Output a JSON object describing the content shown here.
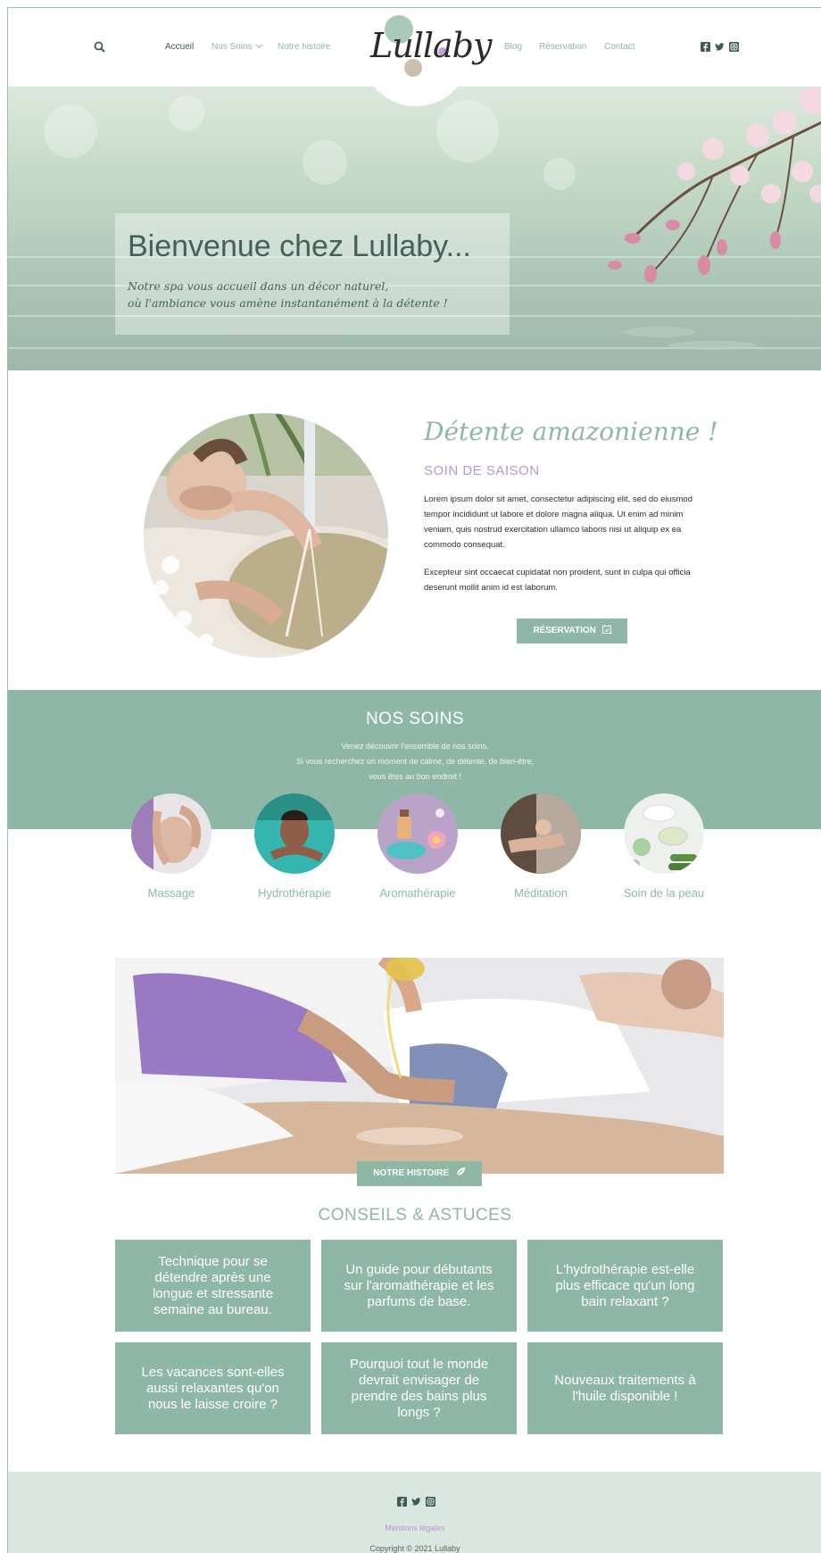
{
  "header": {
    "logo_text": "Lullaby",
    "nav_left": [
      "Accueil",
      "Nos Soins",
      "Notre histoire"
    ],
    "nav_right": [
      "Blog",
      "Réservation",
      "Contact"
    ],
    "social_icons": [
      "facebook-icon",
      "twitter-icon",
      "instagram-icon"
    ]
  },
  "hero": {
    "title": "Bienvenue chez Lullaby...",
    "subtitle_line1": "Notre spa vous accueil dans un décor naturel,",
    "subtitle_line2": "où l'ambiance vous amène instantanément à la détente !"
  },
  "seasonal": {
    "title": "Détente amazonienne !",
    "subtitle": "SOIN DE SAISON",
    "paragraph1": "Lorem ipsum dolor sit amet, consectetur adipiscing elit, sed do eiusmod tempor incididunt ut labore et dolore magna aliqua. Ut enim ad minim veniam, quis nostrud exercitation ullamco laboris nisi ut aliquip ex ea commodo consequat.",
    "paragraph2": "Excepteur sint occaecat cupidatat non proident, sunt in culpa qui officia deserunt mollit anim id est laborum.",
    "button": "RÉSERVATION"
  },
  "soins": {
    "title": "NOS SOINS",
    "intro_line1": "Venez découvrir l'ensemble de nos soins.",
    "intro_line2": "Si vous recherchez un moment de calme, de détente, de bien-être,",
    "intro_line3": "vous êtes au bon endroit !",
    "items": [
      "Massage",
      "Hydrothérapie",
      "Aromathérapie",
      "Méditation",
      "Soin de la peau"
    ]
  },
  "story_button": "NOTRE HISTOIRE",
  "conseils": {
    "title": "CONSEILS & ASTUCES",
    "cards": [
      "Technique pour se détendre après une longue et stressante semaine au bureau.",
      "Un guide pour débutants sur l'aromathérapie et les parfums de base.",
      "L'hydrothérapie est-elle plus efficace qu'un long bain relaxant ?",
      "Les vacances sont-elles aussi relaxantes qu'on nous le laisse croire ?",
      "Pourquoi tout le monde devrait envisager de prendre des bains plus longs ?",
      "Nouveaux traitements à l'huile disponible !"
    ]
  },
  "footer": {
    "legal": "Mentions légales",
    "copyright": "Copyright © 2021 Lullaby"
  },
  "colors": {
    "accent": "#8fb7a7",
    "lavender": "#b797cd",
    "dark": "#3f5b52",
    "footer_bg": "#d9e7e0"
  }
}
